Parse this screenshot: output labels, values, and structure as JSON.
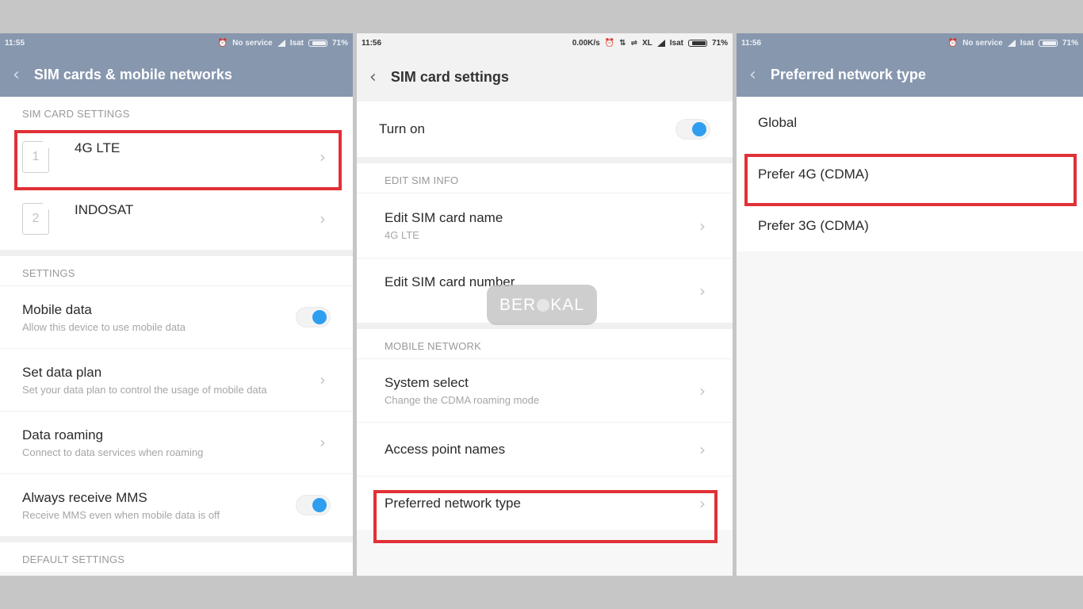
{
  "panels": {
    "sim_networks": {
      "status": {
        "time": "11:55",
        "alarm_icon": "alarm-clock-icon",
        "service": "No service",
        "carrier": "Isat",
        "battery": "71%"
      },
      "title": "SIM cards & mobile networks",
      "back_icon": "chevron-left-icon",
      "sim_section": {
        "header": "SIM CARD SETTINGS",
        "sims": [
          {
            "slot": "1",
            "name": "4G LTE",
            "highlighted": true
          },
          {
            "slot": "2",
            "name": "INDOSAT",
            "highlighted": false
          }
        ]
      },
      "settings_section": {
        "header": "SETTINGS",
        "items": [
          {
            "title": "Mobile data",
            "subtitle": "Allow this device to use mobile data",
            "control": "toggle",
            "on": true
          },
          {
            "title": "Set data plan",
            "subtitle": "Set your data plan to control the usage of mobile data",
            "control": "chevron"
          },
          {
            "title": "Data roaming",
            "subtitle": "Connect to data services when roaming",
            "control": "chevron"
          },
          {
            "title": "Always receive MMS",
            "subtitle": "Receive MMS even when mobile data is off",
            "control": "toggle",
            "on": true
          }
        ]
      },
      "default_section": {
        "header": "DEFAULT SETTINGS"
      }
    },
    "sim_card_settings": {
      "status": {
        "time": "11:56",
        "speed": "0.00K/s",
        "carrier1": "XL",
        "carrier2": "Isat",
        "battery": "71%"
      },
      "title": "SIM card settings",
      "turn_on": {
        "title": "Turn on",
        "on": true
      },
      "edit_section": {
        "header": "EDIT SIM INFO",
        "items": [
          {
            "title": "Edit SIM card name",
            "subtitle": "4G LTE"
          },
          {
            "title": "Edit SIM card number",
            "subtitle": ""
          }
        ]
      },
      "network_section": {
        "header": "MOBILE NETWORK",
        "items": [
          {
            "title": "System select",
            "subtitle": "Change the CDMA roaming mode"
          },
          {
            "title": "Access point names",
            "subtitle": ""
          },
          {
            "title": "Preferred network type",
            "subtitle": "",
            "highlighted": true
          }
        ]
      }
    },
    "preferred_network": {
      "status": {
        "time": "11:56",
        "service": "No service",
        "carrier": "Isat",
        "battery": "71%"
      },
      "title": "Preferred network type",
      "options": [
        {
          "label": "Global",
          "highlighted": false
        },
        {
          "label": "Prefer 4G (CDMA)",
          "highlighted": true
        },
        {
          "label": "Prefer 3G (CDMA)",
          "highlighted": false
        }
      ]
    }
  },
  "watermark": {
    "left": "BER",
    "right": "KAL"
  },
  "colors": {
    "header_bg": "#8797ae",
    "toggle_on": "#2f9ef0",
    "highlight": "#e03137"
  }
}
